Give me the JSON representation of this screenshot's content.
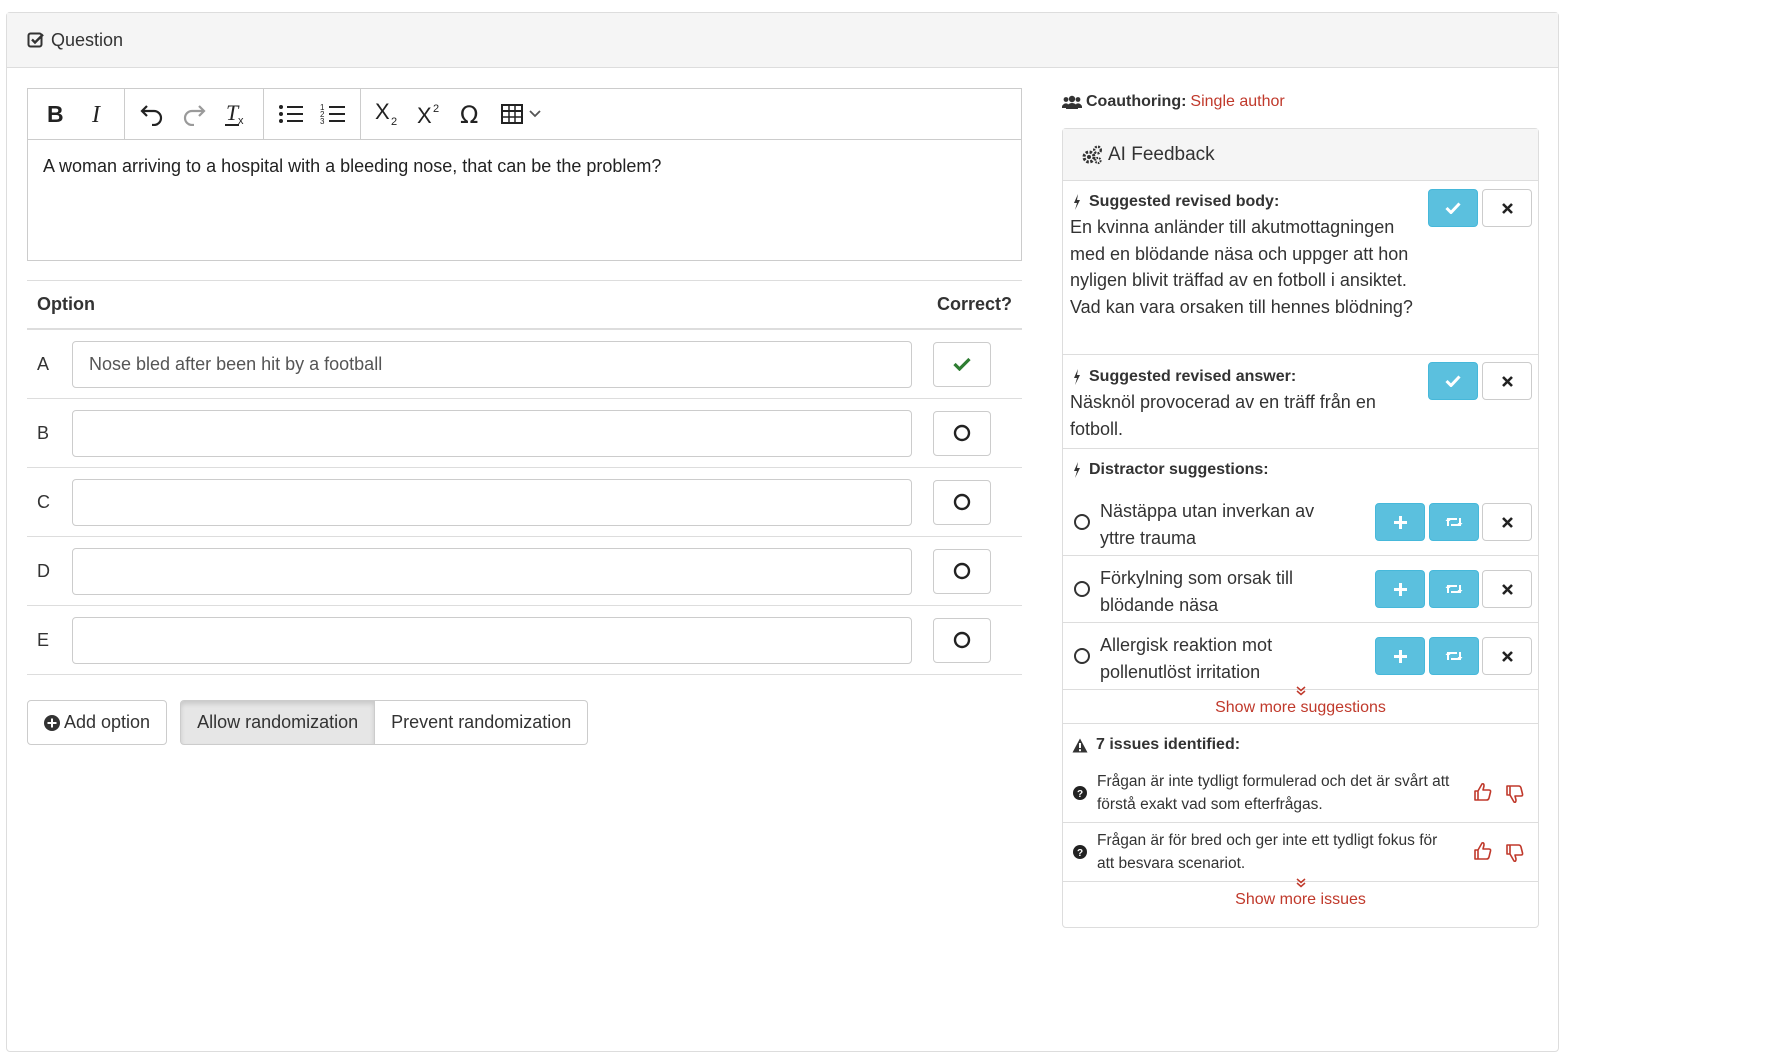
{
  "panel": {
    "title": "Question"
  },
  "editor": {
    "toolbar": [
      "bold",
      "italic",
      "undo",
      "redo",
      "clear-formatting",
      "bullet-list",
      "numbered-list",
      "subscript",
      "superscript",
      "special-character",
      "table"
    ],
    "body": "A woman arriving to a hospital with a bleeding nose, that can be the problem?"
  },
  "options": {
    "header_option": "Option",
    "header_correct": "Correct?",
    "rows": [
      {
        "letter": "A",
        "value": "Nose bled after been hit by a football",
        "correct": true
      },
      {
        "letter": "B",
        "value": "",
        "correct": false
      },
      {
        "letter": "C",
        "value": "",
        "correct": false
      },
      {
        "letter": "D",
        "value": "",
        "correct": false
      },
      {
        "letter": "E",
        "value": "",
        "correct": false
      }
    ]
  },
  "buttons": {
    "add_option": "Add option",
    "allow_randomization": "Allow randomization",
    "prevent_randomization": "Prevent randomization"
  },
  "coauthoring": {
    "label": "Coauthoring:",
    "value": "Single author"
  },
  "ai_feedback": {
    "title": "AI Feedback",
    "body": {
      "title": "Suggested revised body:",
      "text": "En kvinna anländer till akutmottagningen med en blödande näsa och uppger att hon nyligen blivit träffad av en fotboll i ansiktet. Vad kan vara orsaken till hennes blödning?"
    },
    "answer": {
      "title": "Suggested revised answer:",
      "text": "Näsknöl provocerad av en träff från en fotboll."
    },
    "distractors": {
      "title": "Distractor suggestions:",
      "items": [
        "Nästäppa utan inverkan av yttre trauma",
        "Förkylning som orsak till blödande näsa",
        "Allergisk reaktion mot pollenutlöst irritation"
      ],
      "more": "Show more suggestions"
    },
    "issues": {
      "title": "7 issues identified:",
      "items": [
        "Frågan är inte tydligt formulerad och det är svårt att förstå exakt vad som efterfrågas.",
        "Frågan är för bred och ger inte ett tydligt fokus för att besvara scenariot."
      ],
      "more": "Show more issues"
    }
  },
  "colors": {
    "info": "#5bc0de",
    "link": "#c0392b",
    "success": "#2e7d32"
  }
}
